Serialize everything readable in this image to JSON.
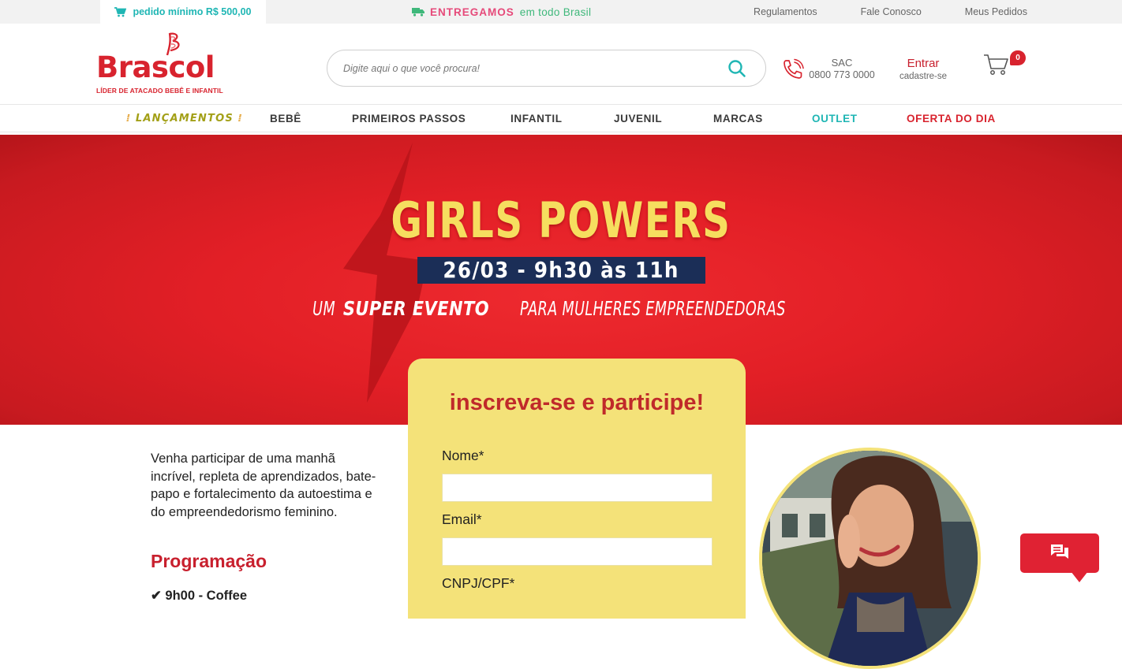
{
  "topbar": {
    "min_order": "pedido mínimo R$ 500,00",
    "delivery_strong": "ENTREGAMOS",
    "delivery_rest": "em todo Brasil",
    "links": [
      "Regulamentos",
      "Fale Conosco",
      "Meus Pedidos"
    ]
  },
  "header": {
    "logo_text": "Brascol",
    "logo_tagline": "LÍDER DE ATACADO BEBÊ E INFANTIL",
    "search_placeholder": "Digite aqui o que você procura!",
    "sac_label": "SAC",
    "sac_phone": "0800 773 0000",
    "login_label": "Entrar",
    "signup_label": "cadastre-se",
    "cart_count": "0"
  },
  "nav": {
    "items": [
      "LANÇAMENTOS",
      "BEBÊ",
      "PRIMEIROS PASSOS",
      "INFANTIL",
      "JUVENIL",
      "MARCAS",
      "OUTLET",
      "OFERTA DO DIA"
    ]
  },
  "banner": {
    "title": "GIRLS POWERS",
    "date": "26/03 - 9h30 às 11h",
    "subtitle_pre": "UM",
    "subtitle_bold": "SUPER EVENTO",
    "subtitle_post": "PARA MULHERES EMPREENDEDORAS"
  },
  "content": {
    "intro": "Venha participar de uma manhã incrível, repleta de aprendizados, bate-papo e fortalecimento da autoestima e do empreendedorismo feminino.",
    "program_title": "Programação",
    "program_first": "✔ 9h00 - Coffee"
  },
  "form": {
    "heading": "inscreva-se e participe!",
    "fields": [
      {
        "label": "Nome*",
        "value": ""
      },
      {
        "label": "Email*",
        "value": ""
      },
      {
        "label": "CNPJ/CPF*",
        "value": ""
      }
    ]
  },
  "colors": {
    "brand_red": "#d8232e",
    "teal": "#1fb6b4",
    "form_yellow": "#f4e279",
    "banner_red": "#e21f26",
    "date_navy": "#1b2e57"
  }
}
